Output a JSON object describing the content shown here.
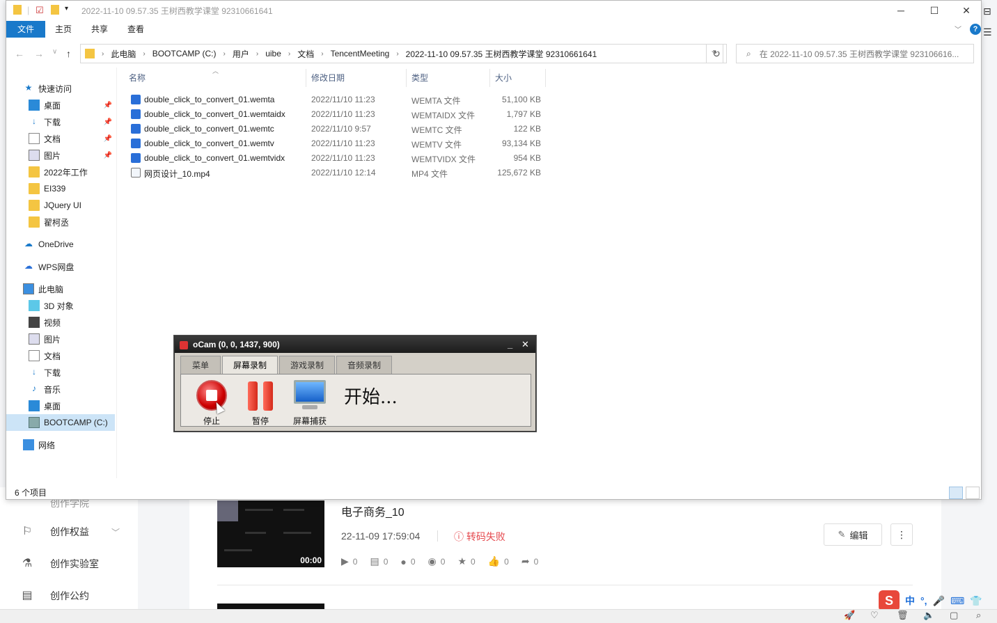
{
  "background_page": {
    "nav": [
      {
        "label": "创作学院"
      },
      {
        "label": "创作权益"
      },
      {
        "label": "创作实验室"
      },
      {
        "label": "创作公约"
      }
    ],
    "video": {
      "title": "电子商务_10",
      "date": "22-11-09 17:59:04",
      "status": "转码失败",
      "duration": "00:00",
      "edit_label": "编辑",
      "more_label": "⋮",
      "stats": [
        "0",
        "0",
        "0",
        "0",
        "0",
        "0",
        "0"
      ]
    },
    "ime": {
      "lang": "中",
      "punct": "°,"
    }
  },
  "explorer": {
    "title": "2022-11-10 09.57.35 王树西教学课堂 92310661641",
    "ribbon_tabs": [
      "文件",
      "主页",
      "共享",
      "查看"
    ],
    "breadcrumb": [
      "此电脑",
      "BOOTCAMP (C:)",
      "用户",
      "uibe",
      "文档",
      "TencentMeeting",
      "2022-11-10 09.57.35 王树西教学课堂 92310661641"
    ],
    "search_placeholder": "在 2022-11-10 09.57.35 王树西教学课堂 923106616...",
    "nav": [
      {
        "label": "快速访问"
      },
      {
        "label": "桌面"
      },
      {
        "label": "下载"
      },
      {
        "label": "文档"
      },
      {
        "label": "图片"
      },
      {
        "label": "2022年工作"
      },
      {
        "label": "EI339"
      },
      {
        "label": "JQuery UI"
      },
      {
        "label": "翟柯丞"
      },
      {
        "label": "OneDrive"
      },
      {
        "label": "WPS网盘"
      },
      {
        "label": "此电脑"
      },
      {
        "label": "3D 对象"
      },
      {
        "label": "视频"
      },
      {
        "label": "图片"
      },
      {
        "label": "文档"
      },
      {
        "label": "下载"
      },
      {
        "label": "音乐"
      },
      {
        "label": "桌面"
      },
      {
        "label": "BOOTCAMP (C:)"
      },
      {
        "label": "网络"
      }
    ],
    "columns": {
      "name": "名称",
      "date": "修改日期",
      "type": "类型",
      "size": "大小"
    },
    "files": [
      {
        "name": "double_click_to_convert_01.wemta",
        "date": "2022/11/10 11:23",
        "type": "WEMTA 文件",
        "size": "51,100 KB"
      },
      {
        "name": "double_click_to_convert_01.wemtaidx",
        "date": "2022/11/10 11:23",
        "type": "WEMTAIDX 文件",
        "size": "1,797 KB"
      },
      {
        "name": "double_click_to_convert_01.wemtc",
        "date": "2022/11/10 9:57",
        "type": "WEMTC 文件",
        "size": "122 KB"
      },
      {
        "name": "double_click_to_convert_01.wemtv",
        "date": "2022/11/10 11:23",
        "type": "WEMTV 文件",
        "size": "93,134 KB"
      },
      {
        "name": "double_click_to_convert_01.wemtvidx",
        "date": "2022/11/10 11:23",
        "type": "WEMTVIDX 文件",
        "size": "954 KB"
      },
      {
        "name": "网页设计_10.mp4",
        "date": "2022/11/10 12:14",
        "type": "MP4 文件",
        "size": "125,672 KB"
      }
    ],
    "status": "6 个项目"
  },
  "ocam": {
    "title": "oCam (0, 0, 1437, 900)",
    "tabs": [
      "菜单",
      "屏幕录制",
      "游戏录制",
      "音频录制"
    ],
    "buttons": {
      "stop": "停止",
      "pause": "暂停",
      "capture": "屏幕捕获"
    },
    "message": "开始..."
  }
}
